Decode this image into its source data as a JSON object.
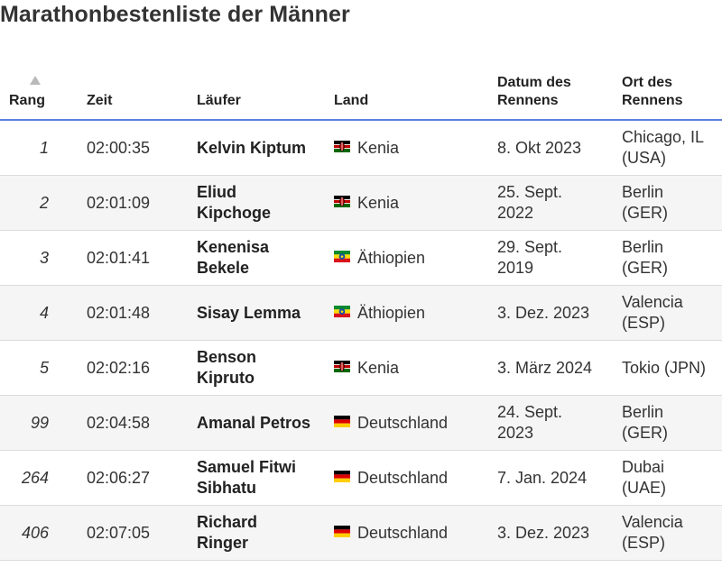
{
  "title": "Marathonbestenliste der Männer",
  "columns": {
    "rank": "Rang",
    "time": "Zeit",
    "runner": "Läufer",
    "country": "Land",
    "date": "Datum des Rennens",
    "place": "Ort des Rennens"
  },
  "sort": {
    "column": "rank",
    "direction": "ascending",
    "icon": "sort-ascending-icon"
  },
  "rows": [
    {
      "rank": "1",
      "time": "02:00:35",
      "runner": "Kelvin Kiptum",
      "flag": "kenya-flag-icon",
      "country": "Kenia",
      "date": "8. Okt 2023",
      "place": "Chicago, IL (USA)"
    },
    {
      "rank": "2",
      "time": "02:01:09",
      "runner": "Eliud Kipchoge",
      "flag": "kenya-flag-icon",
      "country": "Kenia",
      "date": "25. Sept. 2022",
      "place": "Berlin (GER)"
    },
    {
      "rank": "3",
      "time": "02:01:41",
      "runner": "Kenenisa Bekele",
      "flag": "ethiopia-flag-icon",
      "country": "Äthiopien",
      "date": "29. Sept. 2019",
      "place": "Berlin (GER)"
    },
    {
      "rank": "4",
      "time": "02:01:48",
      "runner": "Sisay Lemma",
      "flag": "ethiopia-flag-icon",
      "country": "Äthiopien",
      "date": "3. Dez. 2023",
      "place": "Valencia (ESP)"
    },
    {
      "rank": "5",
      "time": "02:02:16",
      "runner": "Benson Kipruto",
      "flag": "kenya-flag-icon",
      "country": "Kenia",
      "date": "3. März 2024",
      "place": "Tokio (JPN)"
    },
    {
      "rank": "99",
      "time": "02:04:58",
      "runner": "Amanal Petros",
      "flag": "germany-flag-icon",
      "country": "Deutschland",
      "date": "24. Sept. 2023",
      "place": "Berlin (GER)"
    },
    {
      "rank": "264",
      "time": "02:06:27",
      "runner": "Samuel Fitwi Sibhatu",
      "flag": "germany-flag-icon",
      "country": "Deutschland",
      "date": "7. Jan. 2024",
      "place": "Dubai (UAE)"
    },
    {
      "rank": "406",
      "time": "02:07:05",
      "runner": "Richard Ringer",
      "flag": "germany-flag-icon",
      "country": "Deutschland",
      "date": "3. Dez. 2023",
      "place": "Valencia (ESP)"
    }
  ]
}
